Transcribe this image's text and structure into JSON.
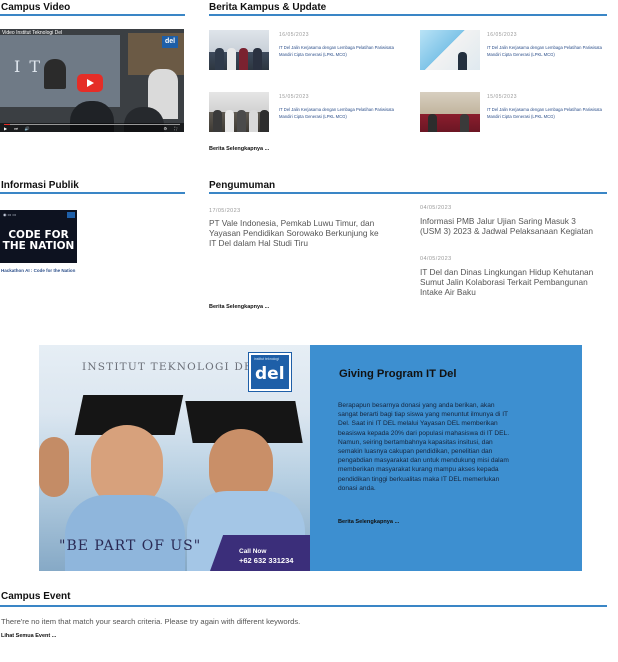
{
  "campus_video": {
    "heading": "Campus Video",
    "video_title": "Video Institut Teknologi Del",
    "logo_text": "del"
  },
  "news": {
    "heading": "Berita Kampus & Update",
    "items": [
      {
        "date": "16/05/2023",
        "title": "IT Del Jalin Kerjasama dengan Lembaga Pelatihan Pariwisata Mandiri Cipta Generasi (LPKL MCG)"
      },
      {
        "date": "16/05/2023",
        "title": "IT Del Jalin Kerjasama dengan Lembaga Pelatihan Pariwisata Mandiri Cipta Generasi (LPKL MCG)"
      },
      {
        "date": "15/05/2023",
        "title": "IT Del Jalin Kerjasama dengan Lembaga Pelatihan Pariwisata Mandiri Cipta Generasi (LPKL MCG)"
      },
      {
        "date": "15/05/2023",
        "title": "IT Del Jalin Kerjasama dengan Lembaga Pelatihan Pariwisata Mandiri Cipta Generasi (LPKL MCG)"
      }
    ],
    "more_link": "Berita Selengkapnya ..."
  },
  "informasi_publik": {
    "heading": "Informasi Publik",
    "card_text": "CODE FOR THE NATION",
    "caption": "Hackathon AI : Code for the Nation"
  },
  "pengumuman": {
    "heading": "Pengumuman",
    "items": [
      {
        "date": "17/05/2023",
        "title": "PT Vale Indonesia, Pemkab Luwu Timur, dan Yayasan Pendidikan Sorowako Berkunjung ke IT Del dalam Hal Studi Tiru"
      },
      {
        "date": "04/05/2023",
        "title": "Informasi PMB Jalur Ujian Saring Masuk 3 (USM 3) 2023 & Jadwal Pelaksanaan Kegiatan"
      },
      {
        "date": "04/05/2023",
        "title": "IT Del dan Dinas Lingkungan Hidup Kehutanan Sumut Jalin Kolaborasi Terkait Pembangunan Intake Air Baku"
      }
    ],
    "more_link": "Berita Selengkapnya ..."
  },
  "giving": {
    "institute": "INSTITUT TEKNOLOGI DEL",
    "logo_small": "institut teknologi",
    "logo": "del",
    "slogan": "\"BE PART OF US\"",
    "call_now": "Call Now",
    "phone": "+62 632 331234",
    "title": "Giving Program IT Del",
    "body": "Berapapun besarnya donasi yang anda berikan, akan sangat berarti bagi tiap siswa yang menuntut ilmunya di IT Del. Saat ini IT DEL melalui Yayasan DEL memberikan beasiswa kepada 20% dari populasi mahasiswa di IT DEL. Namun, seiring bertambahnya kapasitas insitusi, dan semakin luasnya cakupan pendidikan, penelitian dan pengabdian masyarakat dan untuk mendukung misi dalam memberikan masyarakat kurang mampu akses kepada pendidikan tinggi berkualitas maka IT DEL memerlukan donasi anda.",
    "more_link": "Berita Selengkapnya ..."
  },
  "campus_event": {
    "heading": "Campus Event",
    "empty_text": "There're no item that match your search criteria. Please try again with different keywords.",
    "more_link": "Lihat Semua Event ..."
  },
  "colors": {
    "accent_rule": "#3a86c6",
    "banner_blue": "#3d8fd0",
    "link_blue": "#2c4f8a"
  }
}
